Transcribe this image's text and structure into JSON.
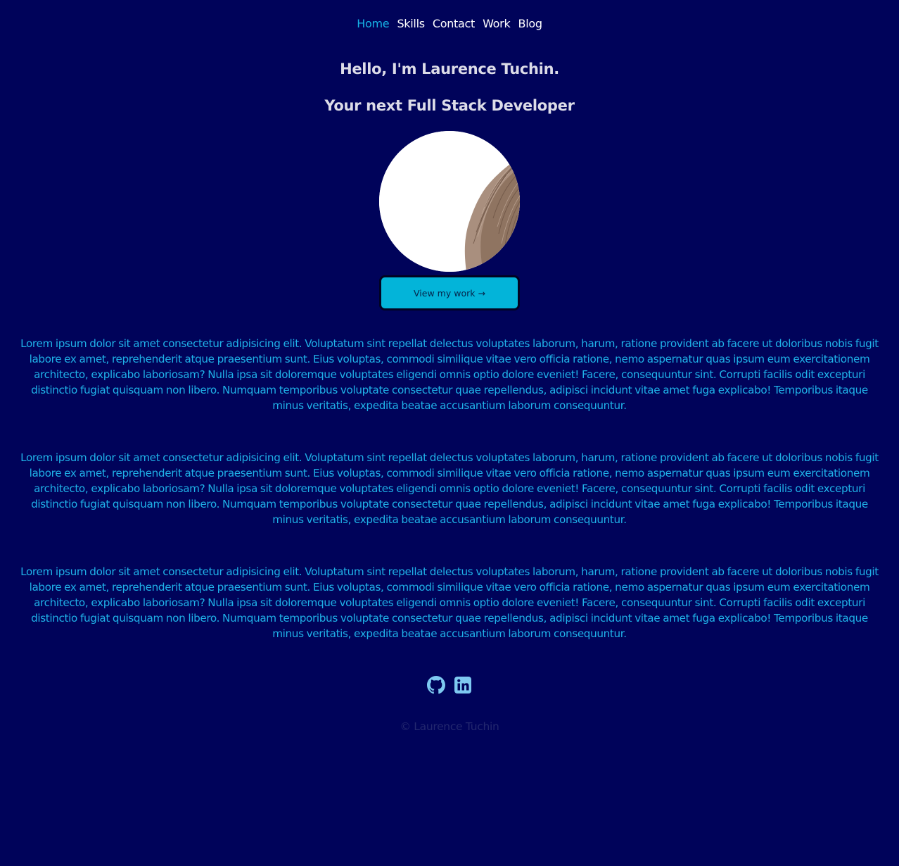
{
  "nav": {
    "items": [
      {
        "label": "Home",
        "active": true
      },
      {
        "label": "Skills",
        "active": false
      },
      {
        "label": "Contact",
        "active": false
      },
      {
        "label": "Work",
        "active": false
      },
      {
        "label": "Blog",
        "active": false
      }
    ]
  },
  "hero": {
    "title": "Hello, I'm Laurence Tuchin.",
    "subtitle": "Your next Full Stack Developer",
    "avatar_alt": "profile-photo",
    "cta_label": "View my work",
    "cta_arrow": "→"
  },
  "content": {
    "paragraphs": [
      "Lorem ipsum dolor sit amet consectetur adipisicing elit. Voluptatum sint repellat delectus voluptates laborum, harum, ratione provident ab facere ut doloribus nobis fugit labore ex amet, reprehenderit atque praesentium sunt. Eius voluptas, commodi similique vitae vero officia ratione, nemo aspernatur quas ipsum eum exercitationem architecto, explicabo laboriosam? Nulla ipsa sit doloremque voluptates eligendi omnis optio dolore eveniet! Facere, consequuntur sint. Corrupti facilis odit excepturi distinctio fugiat quisquam non libero. Numquam temporibus voluptate consectetur quae repellendus, adipisci incidunt vitae amet fuga explicabo! Temporibus itaque minus veritatis, expedita beatae accusantium laborum consequuntur.",
      "Lorem ipsum dolor sit amet consectetur adipisicing elit. Voluptatum sint repellat delectus voluptates laborum, harum, ratione provident ab facere ut doloribus nobis fugit labore ex amet, reprehenderit atque praesentium sunt. Eius voluptas, commodi similique vitae vero officia ratione, nemo aspernatur quas ipsum eum exercitationem architecto, explicabo laboriosam? Nulla ipsa sit doloremque voluptates eligendi omnis optio dolore eveniet! Facere, consequuntur sint. Corrupti facilis odit excepturi distinctio fugiat quisquam non libero. Numquam temporibus voluptate consectetur quae repellendus, adipisci incidunt vitae amet fuga explicabo! Temporibus itaque minus veritatis, expedita beatae accusantium laborum consequuntur.",
      "Lorem ipsum dolor sit amet consectetur adipisicing elit. Voluptatum sint repellat delectus voluptates laborum, harum, ratione provident ab facere ut doloribus nobis fugit labore ex amet, reprehenderit atque praesentium sunt. Eius voluptas, commodi similique vitae vero officia ratione, nemo aspernatur quas ipsum eum exercitationem architecto, explicabo laboriosam? Nulla ipsa sit doloremque voluptates eligendi omnis optio dolore eveniet! Facere, consequuntur sint. Corrupti facilis odit excepturi distinctio fugiat quisquam non libero. Numquam temporibus voluptate consectetur quae repellendus, adipisci incidunt vitae amet fuga explicabo! Temporibus itaque minus veritatis, expedita beatae accusantium laborum consequuntur."
    ]
  },
  "social": {
    "icons": [
      "github-icon",
      "linkedin-icon"
    ]
  },
  "footer": {
    "copyright": "© Laurence Tuchin"
  },
  "colors": {
    "background": "#00035a",
    "accent": "#16b2e5",
    "button": "#03b4d9",
    "text_muted": "#23286f"
  }
}
